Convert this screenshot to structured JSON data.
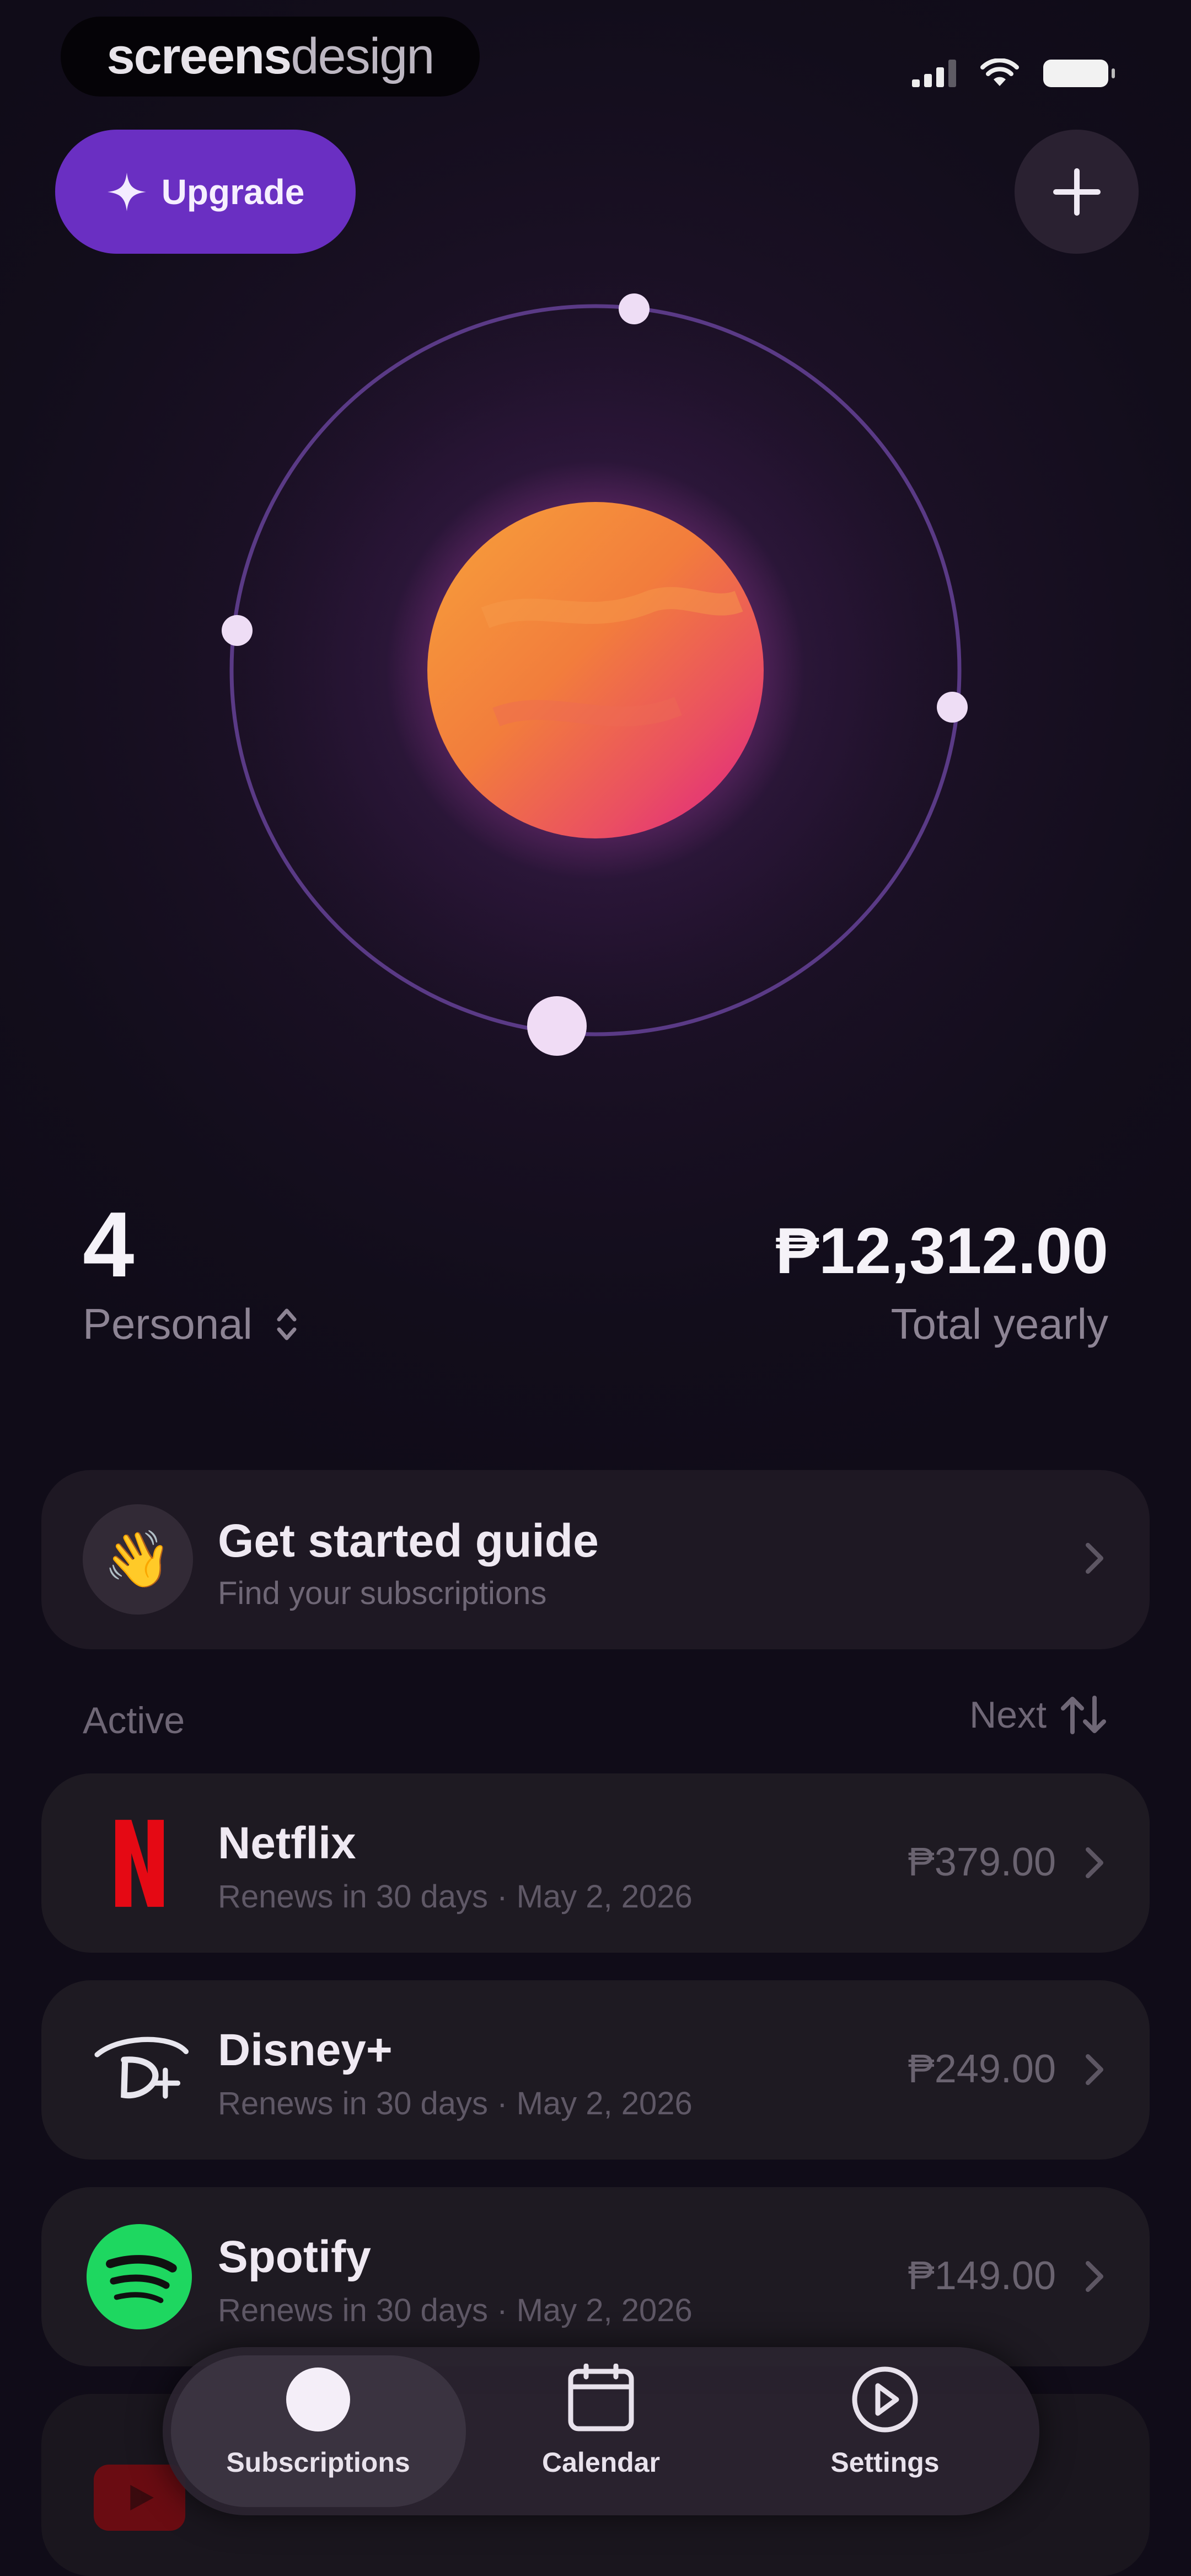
{
  "status_bar": {
    "watermark_bold": "screens",
    "watermark_light": "design"
  },
  "header": {
    "upgrade_label": "Upgrade",
    "add_icon": "plus-icon"
  },
  "summary": {
    "count": "4",
    "profile_label": "Personal",
    "total_amount": "₱12,312.00",
    "total_label": "Total yearly"
  },
  "guide": {
    "title": "Get started guide",
    "subtitle": "Find your subscriptions",
    "icon": "waving-hand-emoji"
  },
  "list": {
    "section_label": "Active",
    "sort_label": "Next",
    "items": [
      {
        "name": "Netflix",
        "meta": "Renews in 30 days · May 2, 2026",
        "price": "₱379.00",
        "logo": "netflix-logo"
      },
      {
        "name": "Disney+",
        "meta": "Renews in 30 days · May 2, 2026",
        "price": "₱249.00",
        "logo": "disney-plus-logo"
      },
      {
        "name": "Spotify",
        "meta": "Renews in 30 days · May 2, 2026",
        "price": "₱149.00",
        "logo": "spotify-logo"
      }
    ]
  },
  "tabbar": {
    "tabs": [
      {
        "label": "Subscriptions",
        "icon": "planet-icon",
        "active": true
      },
      {
        "label": "Calendar",
        "icon": "calendar-icon",
        "active": false
      },
      {
        "label": "Settings",
        "icon": "settings-icon",
        "active": false
      }
    ]
  },
  "colors": {
    "accent": "#6a2fc2",
    "background": "#120d1b",
    "card": "#1e1a22",
    "planet_orange": "#f5902f",
    "planet_pink": "#e0287a"
  }
}
